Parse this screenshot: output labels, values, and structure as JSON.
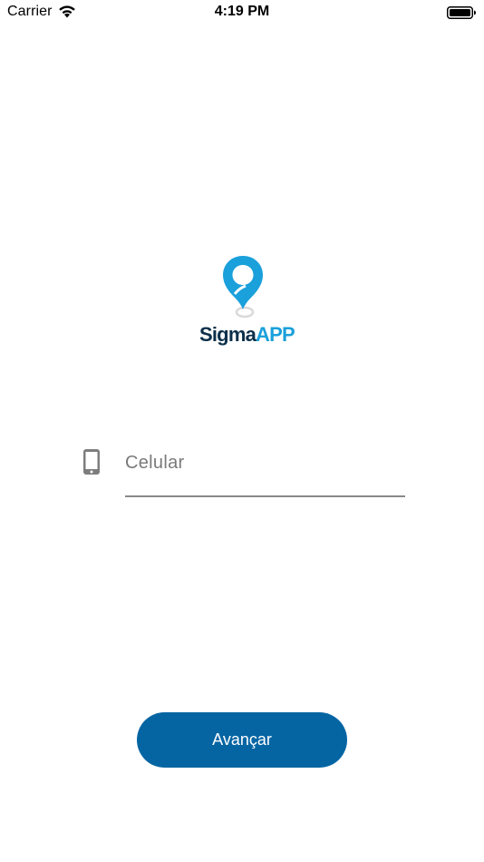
{
  "status_bar": {
    "carrier": "Carrier",
    "time": "4:19 PM",
    "wifi_icon": "wifi-icon",
    "battery_icon": "battery-icon"
  },
  "logo": {
    "icon": "map-pin-icon",
    "text_part1": "Sigma",
    "text_part2": "APP",
    "colors": {
      "pin": "#1aa0db",
      "text_dark": "#0b2f4a",
      "text_accent": "#1aa0db"
    }
  },
  "phone_field": {
    "icon": "mobile-phone-icon",
    "placeholder": "Celular",
    "value": ""
  },
  "advance_button": {
    "label": "Avançar",
    "color": "#0565a3"
  }
}
